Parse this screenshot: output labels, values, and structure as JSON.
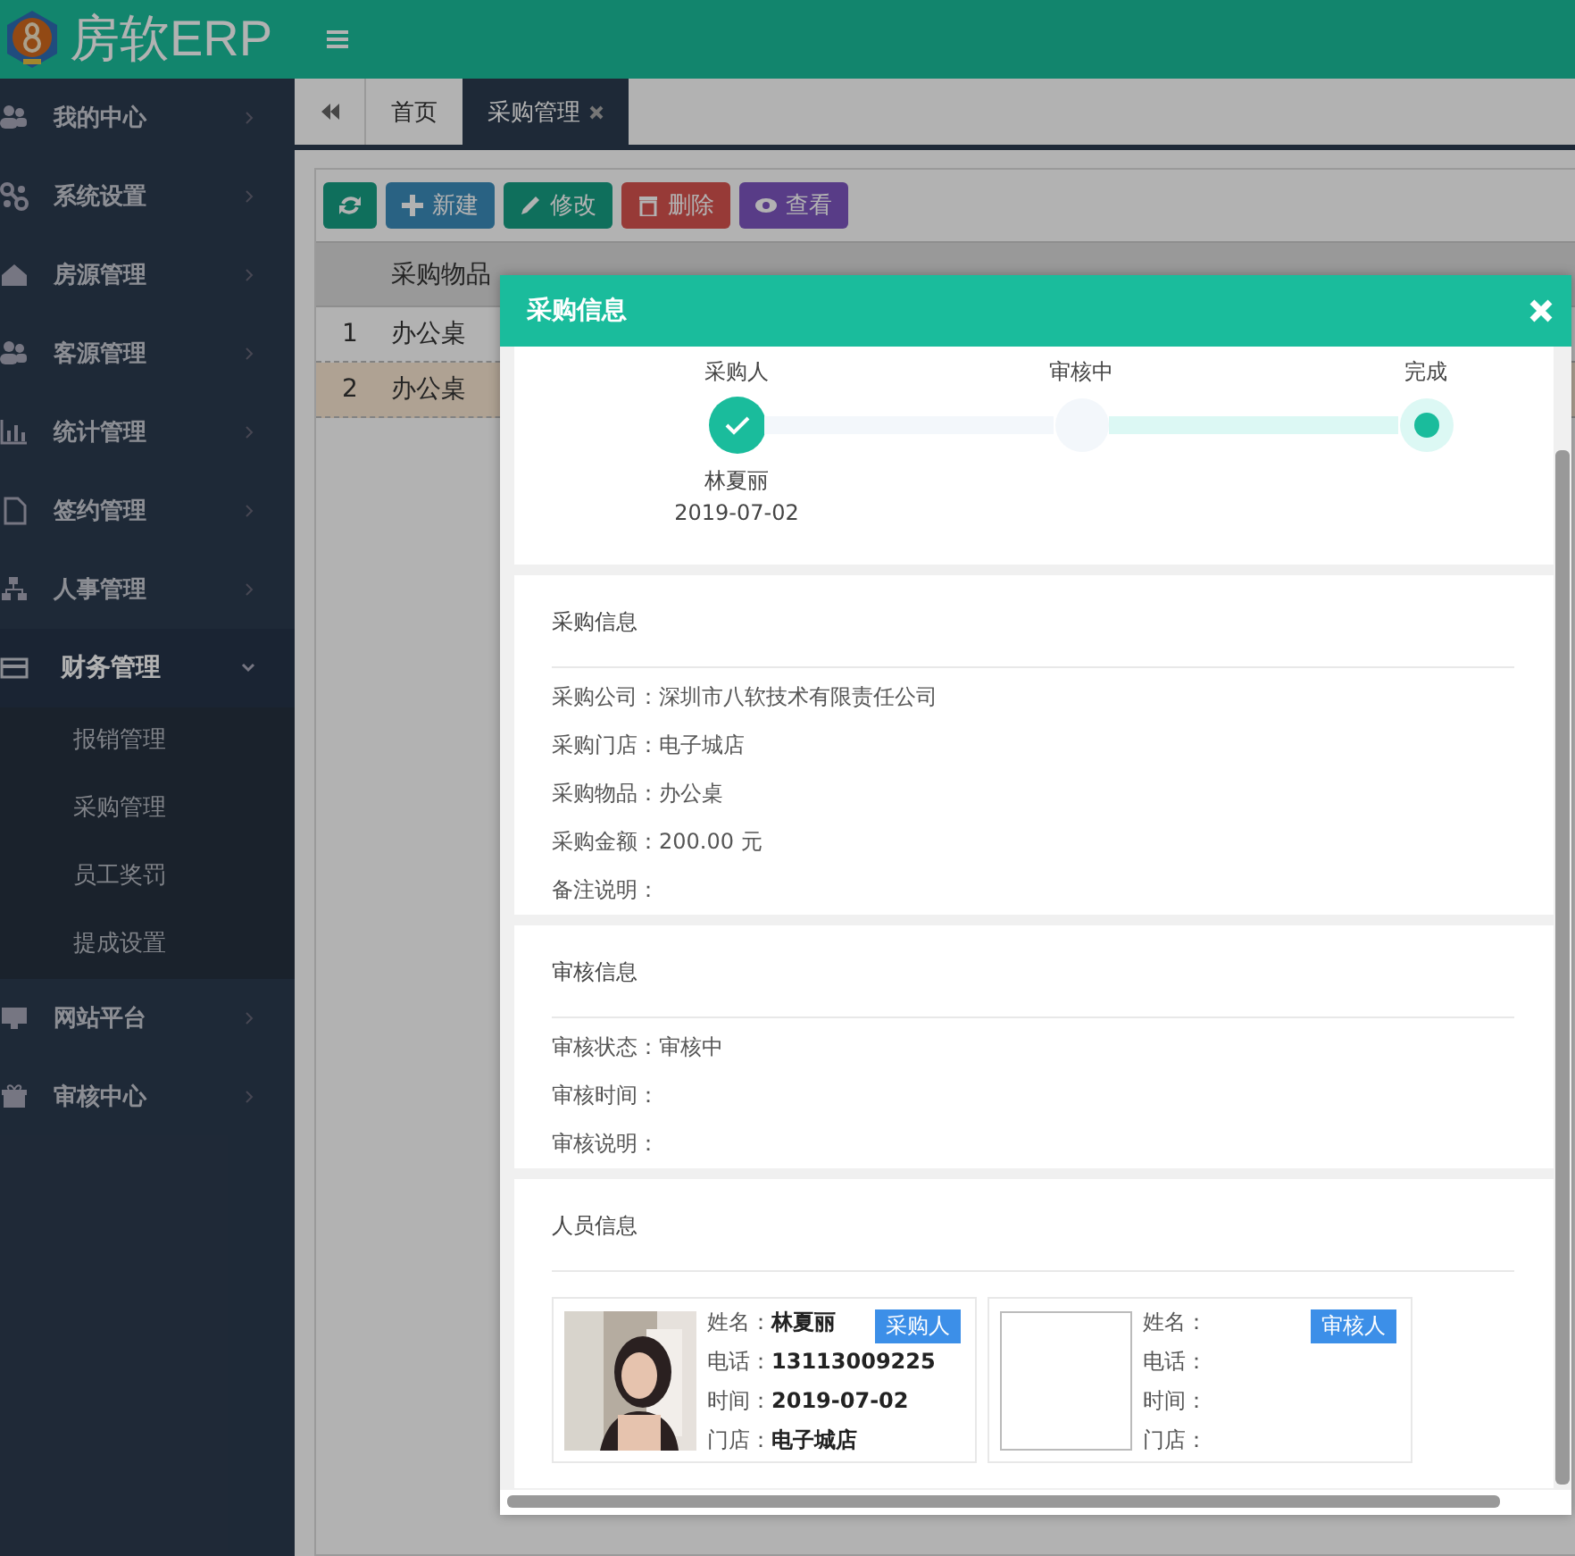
{
  "app": {
    "title": "房软ERP"
  },
  "sidebar": {
    "items": [
      {
        "label": "我的中心",
        "expanded": false
      },
      {
        "label": "系统设置",
        "expanded": false
      },
      {
        "label": "房源管理",
        "expanded": false
      },
      {
        "label": "客源管理",
        "expanded": false
      },
      {
        "label": "统计管理",
        "expanded": false
      },
      {
        "label": "签约管理",
        "expanded": false
      },
      {
        "label": "人事管理",
        "expanded": false
      },
      {
        "label": "财务管理",
        "expanded": true,
        "children": [
          {
            "label": "报销管理"
          },
          {
            "label": "采购管理"
          },
          {
            "label": "员工奖罚"
          },
          {
            "label": "提成设置"
          }
        ]
      },
      {
        "label": "网站平台",
        "expanded": false
      },
      {
        "label": "审核中心",
        "expanded": false
      }
    ]
  },
  "tabs": [
    {
      "label": "首页",
      "selected": false,
      "closable": false
    },
    {
      "label": "采购管理",
      "selected": true,
      "closable": true
    }
  ],
  "toolbar": [
    {
      "kind": "refresh"
    },
    {
      "kind": "add",
      "label": "新建"
    },
    {
      "kind": "edit",
      "label": "修改"
    },
    {
      "kind": "delete",
      "label": "删除"
    },
    {
      "kind": "view",
      "label": "查看"
    }
  ],
  "table": {
    "columns": [
      "采购物品"
    ],
    "rows": [
      {
        "index": "1",
        "item": "办公桌",
        "selected": false
      },
      {
        "index": "2",
        "item": "办公桌",
        "selected": true
      }
    ]
  },
  "dialog": {
    "title": "采购信息",
    "steps": [
      {
        "label": "采购人",
        "kind": "done",
        "person": "林夏丽",
        "date": "2019-07-02"
      },
      {
        "label": "审核中",
        "kind": "pending"
      },
      {
        "label": "完成",
        "kind": "current"
      }
    ],
    "sections": [
      {
        "title": "采购信息",
        "fields": [
          {
            "label": "采购公司：",
            "value": "深圳市八软技术有限责任公司"
          },
          {
            "label": "采购门店：",
            "value": "电子城店"
          },
          {
            "label": "采购物品：",
            "value": "办公桌"
          },
          {
            "label": "采购金额：",
            "value": "200.00 元"
          },
          {
            "label": "备注说明："
          }
        ]
      },
      {
        "title": "审核信息",
        "fields": [
          {
            "label": "审核状态：",
            "value": "审核中"
          },
          {
            "label": "审核时间："
          },
          {
            "label": "审核说明："
          }
        ]
      }
    ],
    "people": {
      "title": "人员信息",
      "cards": [
        {
          "photo": true,
          "role": "采购人",
          "fields": [
            {
              "label": "姓名：",
              "value": "林夏丽"
            },
            {
              "label": "电话：",
              "value": "13113009225"
            },
            {
              "label": "时间：",
              "value": "2019-07-02"
            },
            {
              "label": "门店：",
              "value": "电子城店"
            }
          ]
        },
        {
          "photo": false,
          "role": "审核人",
          "fields": [
            {
              "label": "姓名："
            },
            {
              "label": "电话："
            },
            {
              "label": "时间："
            },
            {
              "label": "门店："
            }
          ]
        }
      ]
    }
  }
}
